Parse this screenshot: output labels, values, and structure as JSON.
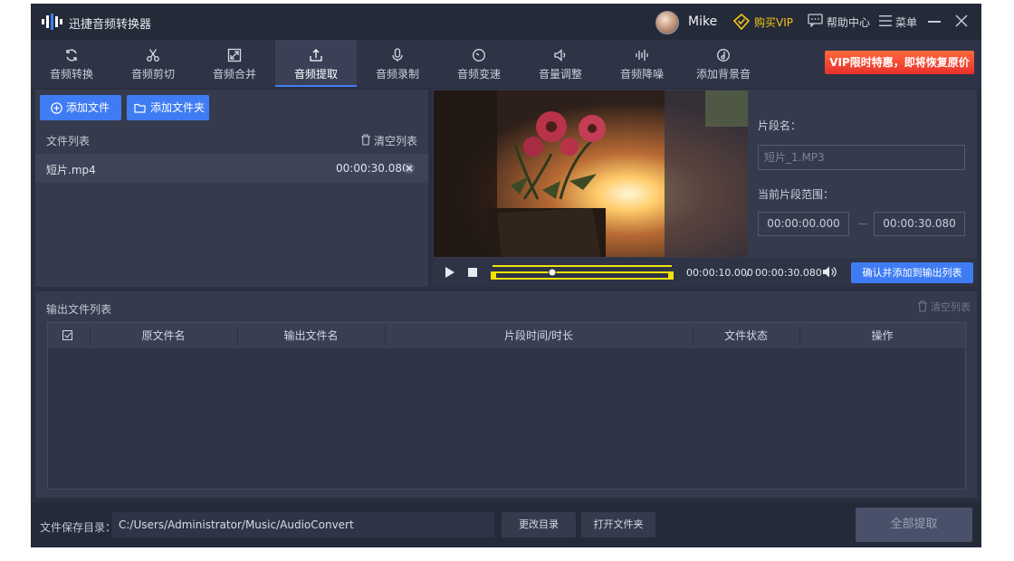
{
  "app": {
    "title": "迅捷音频转换器",
    "username": "Mike",
    "buy_vip": "购买VIP",
    "help": "帮助中心",
    "menu": "菜单"
  },
  "toolbar": {
    "tabs": [
      {
        "label": "音频转换",
        "icon": "refresh-icon"
      },
      {
        "label": "音频剪切",
        "icon": "scissors-icon"
      },
      {
        "label": "音频合并",
        "icon": "merge-icon"
      },
      {
        "label": "音频提取",
        "icon": "export-icon",
        "active": true
      },
      {
        "label": "音频录制",
        "icon": "microphone-icon"
      },
      {
        "label": "音频变速",
        "icon": "speed-icon"
      },
      {
        "label": "音量调整",
        "icon": "volume-icon"
      },
      {
        "label": "音频降噪",
        "icon": "waveform-icon"
      },
      {
        "label": "添加背景音",
        "icon": "music-disc-icon"
      }
    ],
    "promo": "VIP限时特惠，即将恢复原价"
  },
  "files": {
    "add_file": "添加文件",
    "add_folder": "添加文件夹",
    "list_label": "文件列表",
    "clear_list": "清空列表",
    "items": [
      {
        "name": "短片.mp4",
        "duration": "00:00:30.080"
      }
    ]
  },
  "player": {
    "current_time": "00:00:10.000",
    "separator": "/",
    "total_time": "00:00:30.080",
    "progress": 0.33,
    "confirm_label": "确认并添加到输出列表"
  },
  "segment": {
    "name_label": "片段名：",
    "name_value": "短片_1.MP3",
    "range_label": "当前片段范围：",
    "start": "00:00:00.000",
    "end": "00:00:30.080"
  },
  "output": {
    "title": "输出文件列表",
    "clear_list": "清空列表",
    "columns": [
      "原文件名",
      "输出文件名",
      "片段时间/时长",
      "文件状态",
      "操作"
    ]
  },
  "bottom": {
    "save_dir_label": "文件保存目录：",
    "save_dir": "C:/Users/Administrator/Music/AudioConvert",
    "change_dir": "更改目录",
    "open_folder": "打开文件夹",
    "extract_all": "全部提取"
  },
  "colors": {
    "accent": "#3f7cf4",
    "vip_gold": "#f5c518",
    "promo_red": "#e8302c",
    "timeline_yellow": "#f2e200"
  }
}
